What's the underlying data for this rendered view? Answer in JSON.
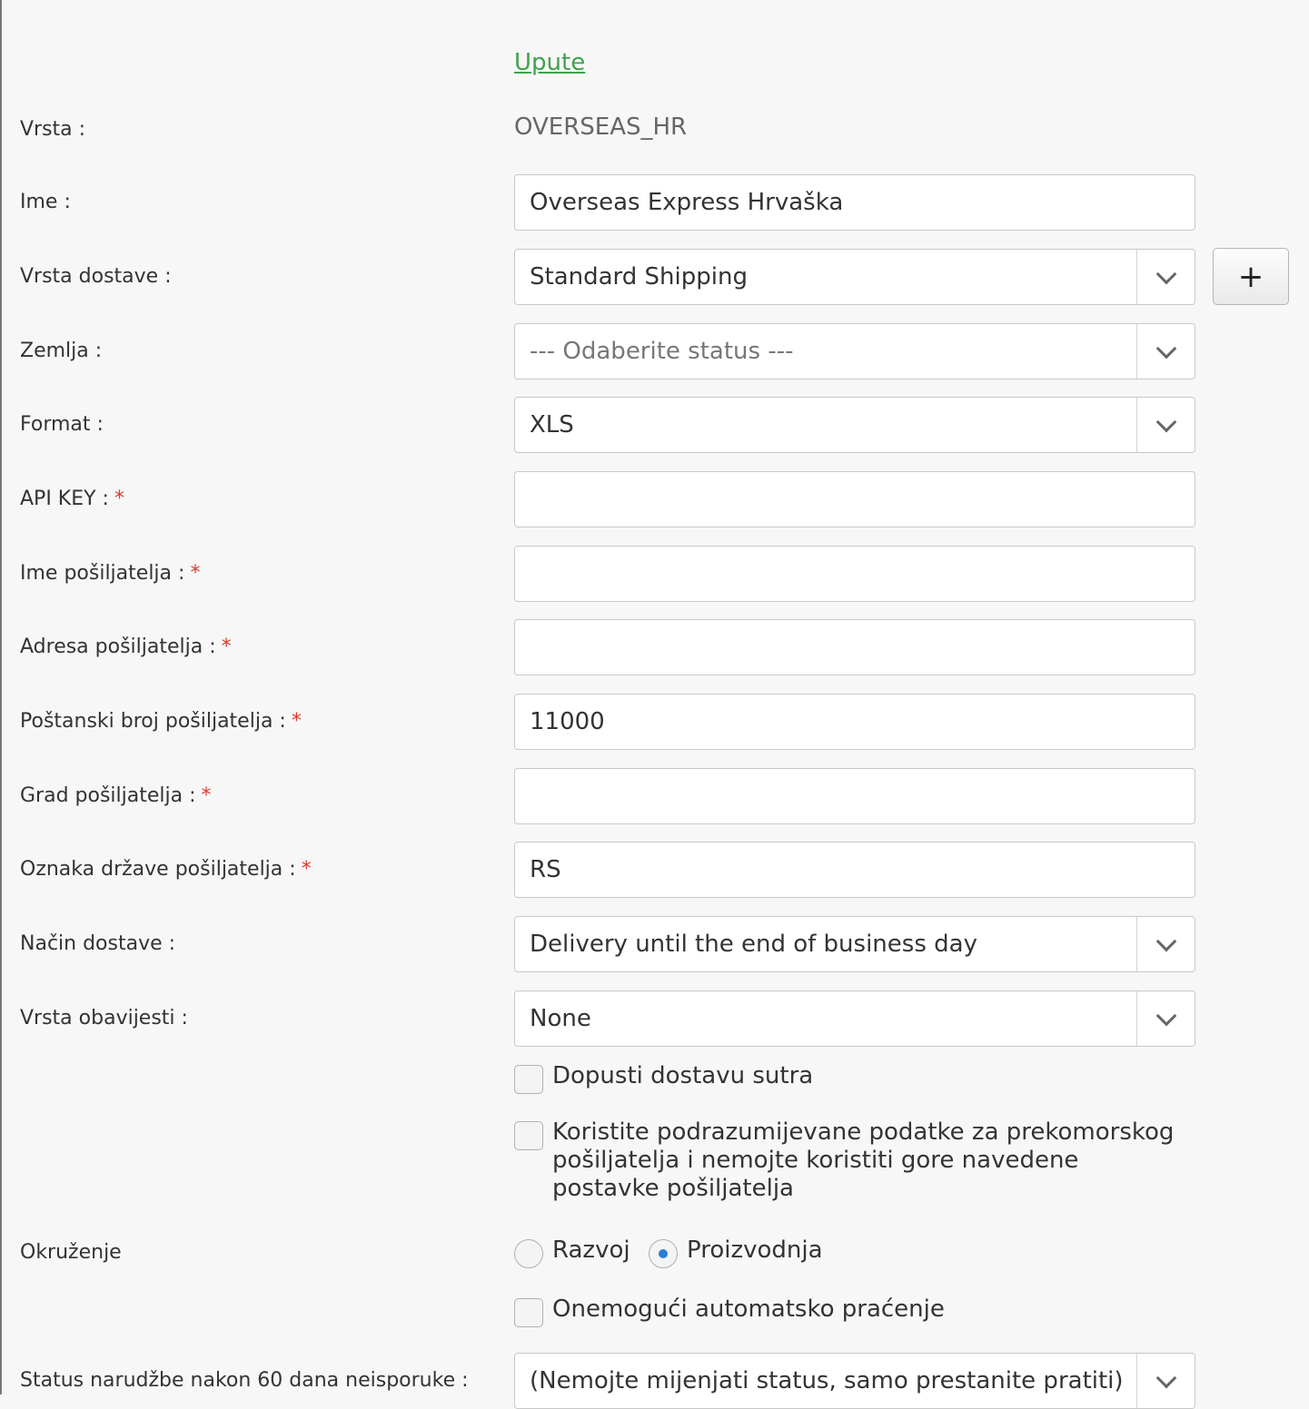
{
  "instructions_link": "Upute",
  "fields": {
    "vrsta": {
      "label": "Vrsta :",
      "value": "OVERSEAS_HR"
    },
    "ime": {
      "label": "Ime :",
      "value": "Overseas Express Hrvaška"
    },
    "vrsta_dostave": {
      "label": "Vrsta dostave :",
      "value": "Standard Shipping",
      "add_button": "+"
    },
    "zemlja": {
      "label": "Zemlja :",
      "placeholder": "--- Odaberite status ---"
    },
    "format": {
      "label": "Format :",
      "value": "XLS"
    },
    "api_key": {
      "label": "API KEY :",
      "required": "*",
      "value": ""
    },
    "ime_posiljatelja": {
      "label": "Ime pošiljatelja :",
      "required": "*",
      "value": ""
    },
    "adresa_posiljatelja": {
      "label": "Adresa pošiljatelja :",
      "required": "*",
      "value": ""
    },
    "postanski_broj": {
      "label": "Poštanski broj pošiljatelja :",
      "required": "*",
      "value": "11000"
    },
    "grad_posiljatelja": {
      "label": "Grad pošiljatelja :",
      "required": "*",
      "value": ""
    },
    "oznaka_drzave": {
      "label": "Oznaka države pošiljatelja :",
      "required": "*",
      "value": "RS"
    },
    "nacin_dostave": {
      "label": "Način dostave :",
      "value": "Delivery until the end of business day"
    },
    "vrsta_obavijesti": {
      "label": "Vrsta obavijesti :",
      "value": "None"
    }
  },
  "checkboxes": {
    "dopusti_sutra": {
      "label": "Dopusti dostavu sutra",
      "checked": false
    },
    "default_sender": {
      "label": "Koristite podrazumijevane podatke za prekomorskog pošiljatelja i nemojte koristiti gore navedene postavke pošiljatelja",
      "checked": false
    },
    "disable_tracking": {
      "label": "Onemogući automatsko praćenje",
      "checked": false
    }
  },
  "environment": {
    "label": "Okruženje",
    "options": [
      {
        "label": "Razvoj",
        "selected": false
      },
      {
        "label": "Proizvodnja",
        "selected": true
      }
    ]
  },
  "order_status": {
    "label": "Status narudžbe nakon 60 dana neisporuke :",
    "value": "(Nemojte mijenjati status, samo prestanite pratiti)"
  },
  "colors": {
    "link": "#3fa34d",
    "required": "#e0392b",
    "radio_selected": "#2a7fd4"
  }
}
